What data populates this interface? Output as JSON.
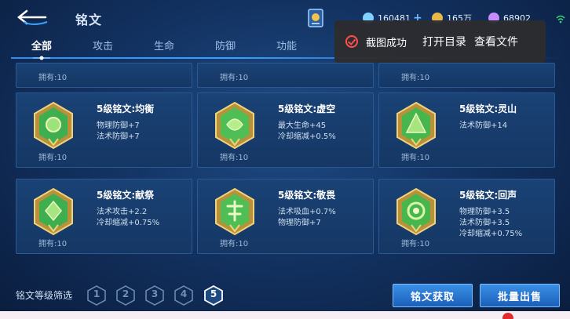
{
  "header": {
    "title": "铭文",
    "currencies": [
      {
        "icon": "gem-icon",
        "value": "160481",
        "has_plus": true,
        "color": "#7fd1ff"
      },
      {
        "icon": "gold-coin-icon",
        "value": "165万",
        "has_plus": false,
        "color": "#e6b84a"
      },
      {
        "icon": "purple-crystal-icon",
        "value": "68902",
        "has_plus": false,
        "color": "#c48cff"
      }
    ]
  },
  "tabs": [
    {
      "label": "全部",
      "active": true
    },
    {
      "label": "攻击",
      "active": false
    },
    {
      "label": "生命",
      "active": false
    },
    {
      "label": "防御",
      "active": false
    },
    {
      "label": "功能",
      "active": false
    }
  ],
  "toast": {
    "message": "截图成功",
    "open_dir": "打开目录",
    "view_file": "查看文件"
  },
  "top_partial_row": [
    {
      "own": "拥有:10"
    },
    {
      "own": "拥有:10"
    },
    {
      "own": "拥有:10"
    }
  ],
  "cards": [
    {
      "name": "5级铭文:均衡",
      "stats": [
        "物理防御+7",
        "法术防御+7"
      ],
      "own": "拥有:10",
      "emblem_color": "#3fae4f"
    },
    {
      "name": "5级铭文:虚空",
      "stats": [
        "最大生命+45",
        "冷却缩减+0.5%"
      ],
      "own": "拥有:10",
      "emblem_color": "#4fbe54"
    },
    {
      "name": "5级铭文:灵山",
      "stats": [
        "法术防御+14"
      ],
      "own": "拥有:10",
      "emblem_color": "#47b64d"
    },
    {
      "name": "5级铭文:献祭",
      "stats": [
        "法术攻击+2.2",
        "冷却缩减+0.75%"
      ],
      "own": "拥有:10",
      "emblem_color": "#3fae4f"
    },
    {
      "name": "5级铭文:敬畏",
      "stats": [
        "法术吸血+0.7%",
        "物理防御+7"
      ],
      "own": "拥有:10",
      "emblem_color": "#4fbe54"
    },
    {
      "name": "5级铭文:回声",
      "stats": [
        "物理防御+3.5",
        "法术防御+3.5",
        "冷却缩减+0.75%"
      ],
      "own": "拥有:10",
      "emblem_color": "#47b64d"
    }
  ],
  "filter": {
    "label": "铭文等级筛选",
    "levels": [
      "1",
      "2",
      "3",
      "4",
      "5"
    ],
    "selected": "5"
  },
  "buttons": {
    "acquire": "铭文获取",
    "bulk_sell": "批量出售"
  }
}
